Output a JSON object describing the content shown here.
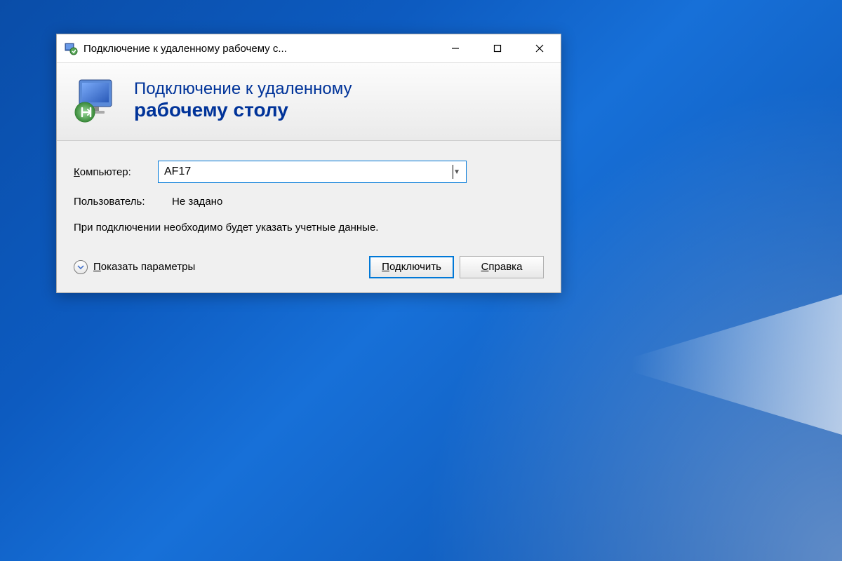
{
  "titlebar": {
    "title": "Подключение к удаленному рабочему с..."
  },
  "header": {
    "line1": "Подключение к удаленному",
    "line2": "рабочему столу"
  },
  "form": {
    "computer_label": "Компьютер:",
    "computer_value": "AF17",
    "user_label": "Пользователь:",
    "user_value": "Не задано",
    "note": "При подключении необходимо будет указать учетные данные."
  },
  "footer": {
    "show_options": "Показать параметры",
    "connect": "Подключить",
    "help": "Справка"
  }
}
